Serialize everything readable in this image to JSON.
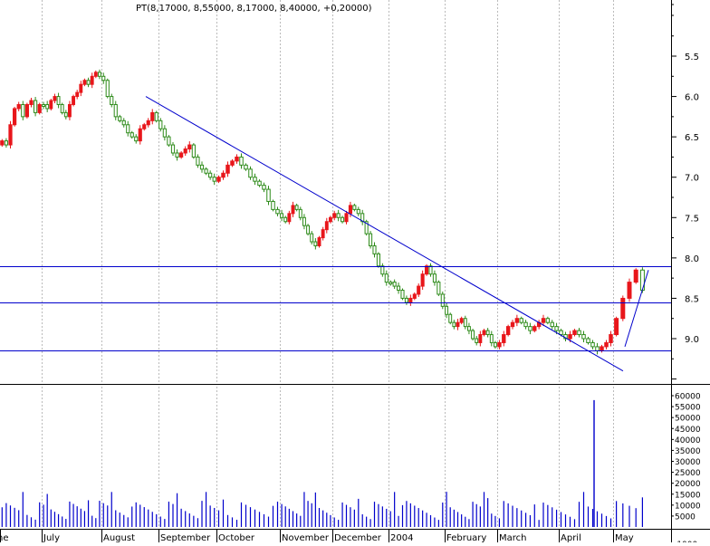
{
  "colors": {
    "up": "#e8161b",
    "down": "#2e8b1a",
    "lines": "#0000cc",
    "volume": "#0000cc",
    "grid": "#bbbbbb",
    "axis": "#000000"
  },
  "chart_data": [
    {
      "type": "candlestick",
      "title": "PT(8,17000, 8,55000, 8,17000, 8,40000, +0,20000)",
      "y_axis": {
        "ticks": [
          "5.5",
          "6.0",
          "6.5",
          "7.0",
          "7.5",
          "8.0",
          "8.5",
          "9.0"
        ],
        "tick_values": [
          5.5,
          6.0,
          6.5,
          7.0,
          7.5,
          8.0,
          8.5,
          9.0
        ],
        "range": [
          5.0,
          9.5
        ],
        "inverted": true,
        "position": "right"
      },
      "x_axis": {
        "labels": [
          "ne",
          "July",
          "August",
          "September",
          "October",
          "November",
          "December",
          "2004",
          "February",
          "March",
          "April",
          "May"
        ]
      },
      "grid": "vertical dotted",
      "series": [
        {
          "kind": "price",
          "approximate_closes": [
            [
              6.55,
              6.6,
              6.35,
              6.15,
              6.1,
              6.25,
              6.1,
              6.05,
              6.2,
              6.1
            ],
            [
              6.1,
              6.15,
              6.05,
              6.0,
              6.1,
              6.2,
              6.25,
              6.1,
              6.0,
              5.95,
              5.85,
              5.8,
              5.85,
              5.75,
              5.7,
              5.75
            ],
            [
              5.8,
              6.0,
              6.1,
              6.25,
              6.3,
              6.35,
              6.45,
              6.5,
              6.55,
              6.4,
              6.35,
              6.3,
              6.2,
              6.3
            ],
            [
              6.4,
              6.5,
              6.6,
              6.7,
              6.75,
              6.7,
              6.65,
              6.6,
              6.75,
              6.85,
              6.9,
              6.95,
              7.0,
              7.05
            ],
            [
              7.0,
              6.95,
              6.85,
              6.8,
              6.75,
              6.85,
              6.9,
              7.0,
              7.05,
              7.1,
              7.15,
              7.3,
              7.4,
              7.45
            ],
            [
              7.5,
              7.55,
              7.45,
              7.35,
              7.4,
              7.5,
              7.6,
              7.7,
              7.8,
              7.85,
              7.75,
              7.65,
              7.55,
              7.5
            ],
            [
              7.45,
              7.5,
              7.55,
              7.45,
              7.35,
              7.4,
              7.45,
              7.55,
              7.7,
              7.85,
              7.95,
              8.1,
              8.2,
              8.3
            ],
            [
              8.3,
              8.35,
              8.4,
              8.5,
              8.55,
              8.5,
              8.45,
              8.35,
              8.2,
              8.1,
              8.2,
              8.3,
              8.45,
              8.6
            ],
            [
              8.7,
              8.8,
              8.85,
              8.8,
              8.75,
              8.85,
              8.9,
              9.0,
              9.05,
              8.95,
              8.9,
              8.95,
              9.05,
              9.1
            ],
            [
              9.05,
              8.95,
              8.85,
              8.8,
              8.75,
              8.8,
              8.85,
              8.9,
              8.85,
              8.8,
              8.75,
              8.8,
              8.85,
              8.9
            ],
            [
              8.95,
              9.0,
              8.95,
              8.9,
              8.95,
              9.0,
              9.05,
              9.1,
              9.15,
              9.1,
              9.05,
              8.95
            ],
            [
              8.75,
              8.5,
              8.3,
              8.15,
              8.4
            ]
          ]
        }
      ],
      "lines": [
        {
          "kind": "trendline",
          "from": {
            "x": "July 31",
            "y": 6.0
          },
          "to": {
            "x": "May 4",
            "y": 9.4
          }
        },
        {
          "kind": "trendline",
          "from": {
            "x": "May 7",
            "y": 9.1
          },
          "to": {
            "x": "May 14",
            "y": 8.15
          }
        },
        {
          "kind": "horizontal",
          "y": 8.1
        },
        {
          "kind": "horizontal",
          "y": 8.55
        },
        {
          "kind": "horizontal",
          "y": 9.15
        }
      ]
    },
    {
      "type": "bar",
      "title": "volume",
      "y_axis": {
        "ticks": [
          "60000",
          "55000",
          "50000",
          "45000",
          "40000",
          "35000",
          "30000",
          "25000",
          "20000",
          "15000",
          "10000",
          "5000",
          "x1000"
        ],
        "tick_values": [
          60000,
          55000,
          50000,
          45000,
          40000,
          35000,
          30000,
          25000,
          20000,
          15000,
          10000,
          5000
        ],
        "range": [
          0,
          62500
        ],
        "position": "right"
      },
      "spike": {
        "x": "April 29",
        "value": 58000
      }
    }
  ]
}
